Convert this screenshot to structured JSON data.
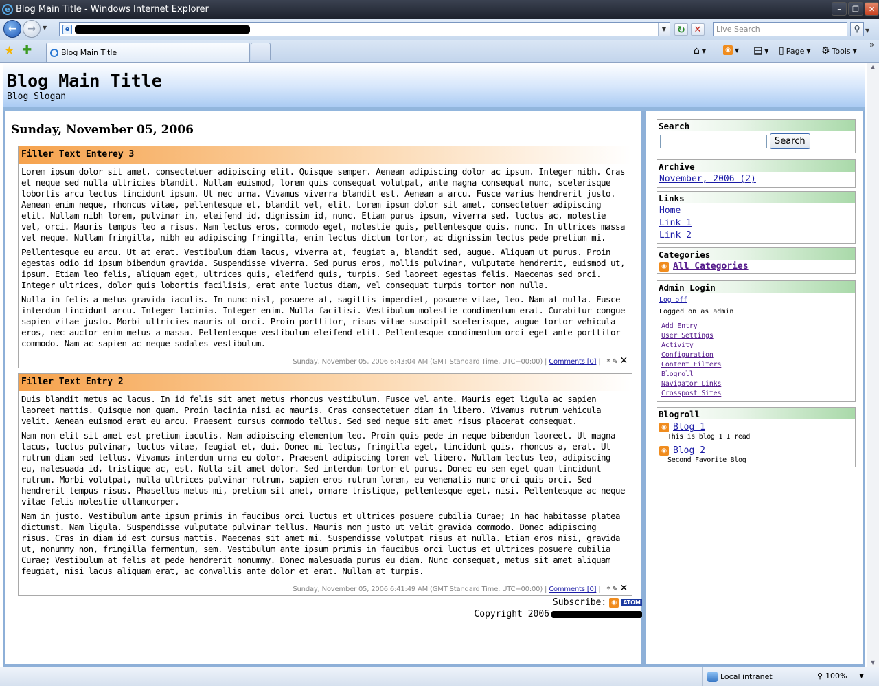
{
  "window": {
    "title": "Blog Main Title - Windows Internet Explorer"
  },
  "address_bar": {
    "live_search_placeholder": "Live Search"
  },
  "tab": {
    "label": "Blog Main Title"
  },
  "command_bar": {
    "page_label": "Page",
    "tools_label": "Tools"
  },
  "blog": {
    "title": "Blog Main Title",
    "slogan": "Blog Slogan"
  },
  "main": {
    "day_heading": "Sunday, November 05, 2006",
    "posts": [
      {
        "title": "Filler Text Enterey 3",
        "paragraphs": [
          "Lorem ipsum dolor sit amet, consectetuer adipiscing elit. Quisque semper. Aenean adipiscing dolor ac ipsum. Integer nibh. Cras et neque sed nulla ultricies blandit. Nullam euismod, lorem quis consequat volutpat, ante magna consequat nunc, scelerisque lobortis arcu lectus tincidunt ipsum. Ut nec urna. Vivamus viverra blandit est. Aenean a arcu. Fusce varius hendrerit justo. Aenean enim neque, rhoncus vitae, pellentesque et, blandit vel, elit. Lorem ipsum dolor sit amet, consectetuer adipiscing elit. Nullam nibh lorem, pulvinar in, eleifend id, dignissim id, nunc. Etiam purus ipsum, viverra sed, luctus ac, molestie vel, orci. Mauris tempus leo a risus. Nam lectus eros, commodo eget, molestie quis, pellentesque quis, nunc. In ultrices massa vel neque. Nullam fringilla, nibh eu adipiscing fringilla, enim lectus dictum tortor, ac dignissim lectus pede pretium mi.",
          "Pellentesque eu arcu. Ut at erat. Vestibulum diam lacus, viverra at, feugiat a, blandit sed, augue. Aliquam ut purus. Proin egestas odio id ipsum bibendum gravida. Suspendisse viverra. Sed purus eros, mollis pulvinar, vulputate hendrerit, euismod ut, ipsum. Etiam leo felis, aliquam eget, ultrices quis, eleifend quis, turpis. Sed laoreet egestas felis. Maecenas sed orci. Integer ultrices, dolor quis lobortis facilisis, erat ante luctus diam, vel consequat turpis tortor non nulla.",
          "Nulla in felis a metus gravida iaculis. In nunc nisl, posuere at, sagittis imperdiet, posuere vitae, leo. Nam at nulla. Fusce interdum tincidunt arcu. Integer lacinia. Integer enim. Nulla facilisi. Vestibulum molestie condimentum erat. Curabitur congue sapien vitae justo. Morbi ultricies mauris ut orci. Proin porttitor, risus vitae suscipit scelerisque, augue tortor vehicula eros, nec auctor enim metus a massa. Pellentesque vestibulum eleifend elit. Pellentesque condimentum orci eget ante porttitor commodo. Nam ac sapien ac neque sodales vestibulum."
        ],
        "timestamp": "Sunday, November 05, 2006 6:43:04 AM (GMT Standard Time, UTC+00:00)",
        "comments": "Comments [0]"
      },
      {
        "title": "Filler Text Entry 2",
        "paragraphs": [
          "Duis blandit metus ac lacus. In id felis sit amet metus rhoncus vestibulum. Fusce vel ante. Mauris eget ligula ac sapien laoreet mattis. Quisque non quam. Proin lacinia nisi ac mauris. Cras consectetuer diam in libero. Vivamus rutrum vehicula velit. Aenean euismod erat eu arcu. Praesent cursus commodo tellus. Sed sed neque sit amet risus placerat consequat.",
          "Nam non elit sit amet est pretium iaculis. Nam adipiscing elementum leo. Proin quis pede in neque bibendum laoreet. Ut magna lacus, luctus pulvinar, luctus vitae, feugiat et, dui. Donec mi lectus, fringilla eget, tincidunt quis, rhoncus a, erat. Ut rutrum diam sed tellus. Vivamus interdum urna eu dolor. Praesent adipiscing lorem vel libero. Nullam lectus leo, adipiscing eu, malesuada id, tristique ac, est. Nulla sit amet dolor. Sed interdum tortor et purus. Donec eu sem eget quam tincidunt rutrum. Morbi volutpat, nulla ultrices pulvinar rutrum, sapien eros rutrum lorem, eu venenatis nunc orci quis orci. Sed hendrerit tempus risus. Phasellus metus mi, pretium sit amet, ornare tristique, pellentesque eget, nisi. Pellentesque ac neque vitae felis molestie ullamcorper.",
          "Nam in justo. Vestibulum ante ipsum primis in faucibus orci luctus et ultrices posuere cubilia Curae; In hac habitasse platea dictumst. Nam ligula. Suspendisse vulputate pulvinar tellus. Mauris non justo ut velit gravida commodo. Donec adipiscing risus. Cras in diam id est cursus mattis. Maecenas sit amet mi. Suspendisse volutpat risus at nulla. Etiam eros nisi, gravida ut, nonummy non, fringilla fermentum, sem. Vestibulum ante ipsum primis in faucibus orci luctus et ultrices posuere cubilia Curae; Vestibulum at felis at pede hendrerit nonummy. Donec malesuada purus eu diam. Nunc consequat, metus sit amet aliquam feugiat, nisi lacus aliquam erat, ac convallis ante dolor et erat. Nullam at turpis."
        ],
        "timestamp": "Sunday, November 05, 2006 6:41:49 AM (GMT Standard Time, UTC+00:00)",
        "comments": "Comments [0]"
      }
    ],
    "subscribe_label": "Subscribe:",
    "atom_label": "ATOM",
    "copyright": "Copyright 2006"
  },
  "sidebar": {
    "search": {
      "heading": "Search",
      "button": "Search"
    },
    "archive": {
      "heading": "Archive",
      "items": [
        "November, 2006 (2)"
      ]
    },
    "links": {
      "heading": "Links",
      "items": [
        "Home",
        "Link 1",
        "Link 2"
      ]
    },
    "categories": {
      "heading": "Categories",
      "all": "All Categories"
    },
    "admin": {
      "heading": "Admin Login",
      "logoff": "Log off",
      "status": "Logged on as admin",
      "items": [
        "Add Entry",
        "User Settings",
        "Activity",
        "Configuration",
        "Content Filters",
        "Blogroll",
        "Navigator Links",
        "Crosspost Sites"
      ]
    },
    "blogroll": {
      "heading": "Blogroll",
      "items": [
        {
          "name": "Blog 1",
          "desc": "This is blog 1 I read"
        },
        {
          "name": "Blog 2",
          "desc": "Second Favorite Blog"
        }
      ]
    }
  },
  "statusbar": {
    "zone": "Local intranet",
    "zoom": "100%"
  }
}
